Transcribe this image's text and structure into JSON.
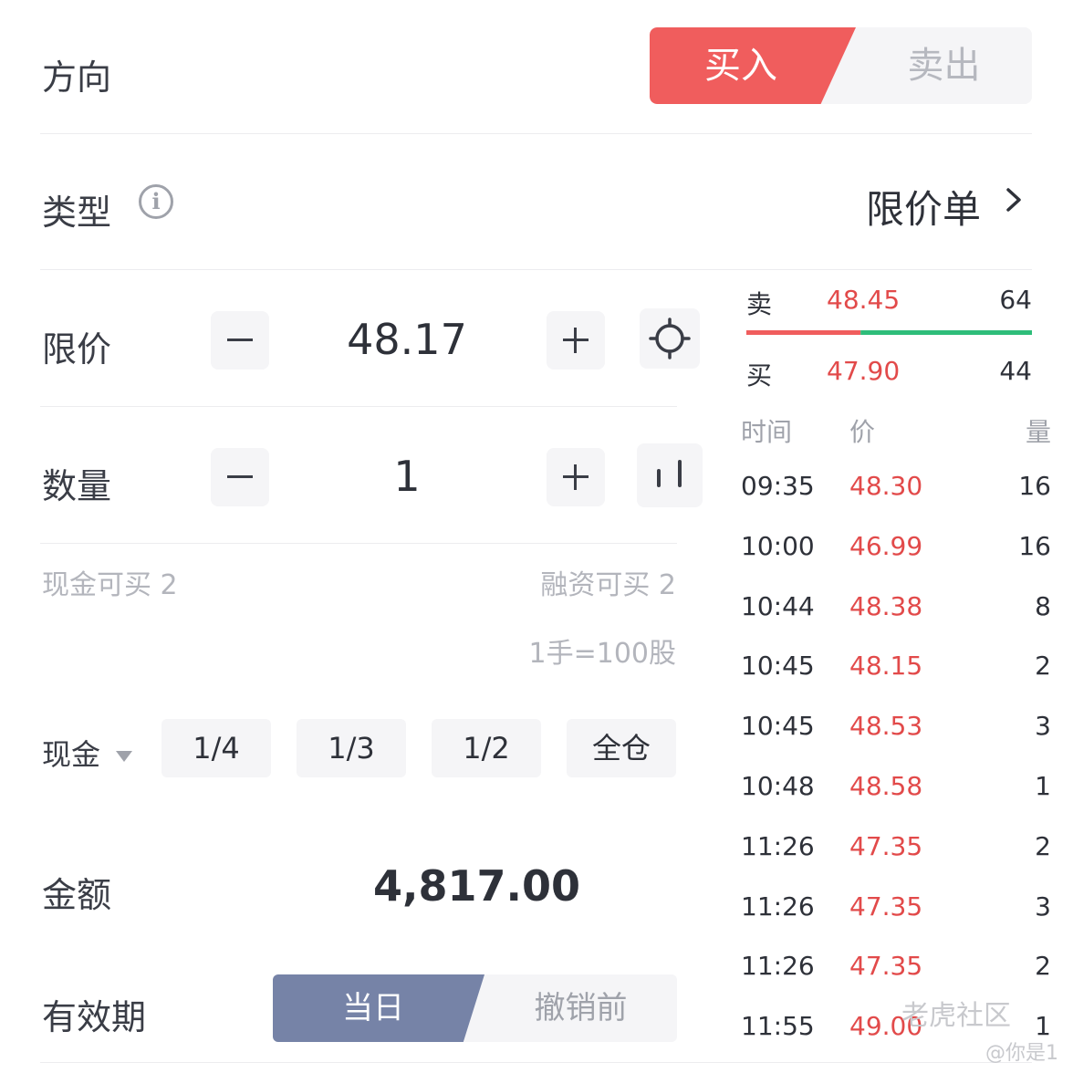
{
  "direction": {
    "label": "方向",
    "buy": "买入",
    "sell": "卖出",
    "selected": "buy"
  },
  "order_type": {
    "label": "类型",
    "value": "限价单"
  },
  "limit_price": {
    "label": "限价",
    "value": "48.17"
  },
  "quantity": {
    "label": "数量",
    "value": "1"
  },
  "buyable": {
    "cash": "现金可买 2",
    "margin": "融资可买 2",
    "lot_note": "1手=100股"
  },
  "ratio": {
    "account_label": "现金",
    "options": [
      "1/4",
      "1/3",
      "1/2",
      "全仓"
    ]
  },
  "amount": {
    "label": "金额",
    "value": "4,817.00"
  },
  "validity": {
    "label": "有效期",
    "today": "当日",
    "gtc": "撤销前",
    "selected": "today"
  },
  "order_book": {
    "ask": {
      "side": "卖",
      "price": "48.45",
      "qty": "64"
    },
    "bid": {
      "side": "买",
      "price": "47.90",
      "qty": "44"
    },
    "bid_ratio": 0.4
  },
  "trades": {
    "headers": {
      "time": "时间",
      "price": "价",
      "qty": "量"
    },
    "rows": [
      {
        "time": "09:35",
        "price": "48.30",
        "qty": "16"
      },
      {
        "time": "10:00",
        "price": "46.99",
        "qty": "16"
      },
      {
        "time": "10:44",
        "price": "48.38",
        "qty": "8"
      },
      {
        "time": "10:45",
        "price": "48.15",
        "qty": "2"
      },
      {
        "time": "10:45",
        "price": "48.53",
        "qty": "3"
      },
      {
        "time": "10:48",
        "price": "48.58",
        "qty": "1"
      },
      {
        "time": "11:26",
        "price": "47.35",
        "qty": "2"
      },
      {
        "time": "11:26",
        "price": "47.35",
        "qty": "3"
      },
      {
        "time": "11:26",
        "price": "47.35",
        "qty": "2"
      },
      {
        "time": "11:55",
        "price": "49.00",
        "qty": "1"
      }
    ]
  },
  "watermark": {
    "brand": "老虎社区",
    "user": "@你是1"
  },
  "colors": {
    "buy_red": "#f05d5d",
    "price_red": "#e24a4a",
    "bid_green": "#2ebd7a",
    "validity_blue": "#7683a7"
  }
}
